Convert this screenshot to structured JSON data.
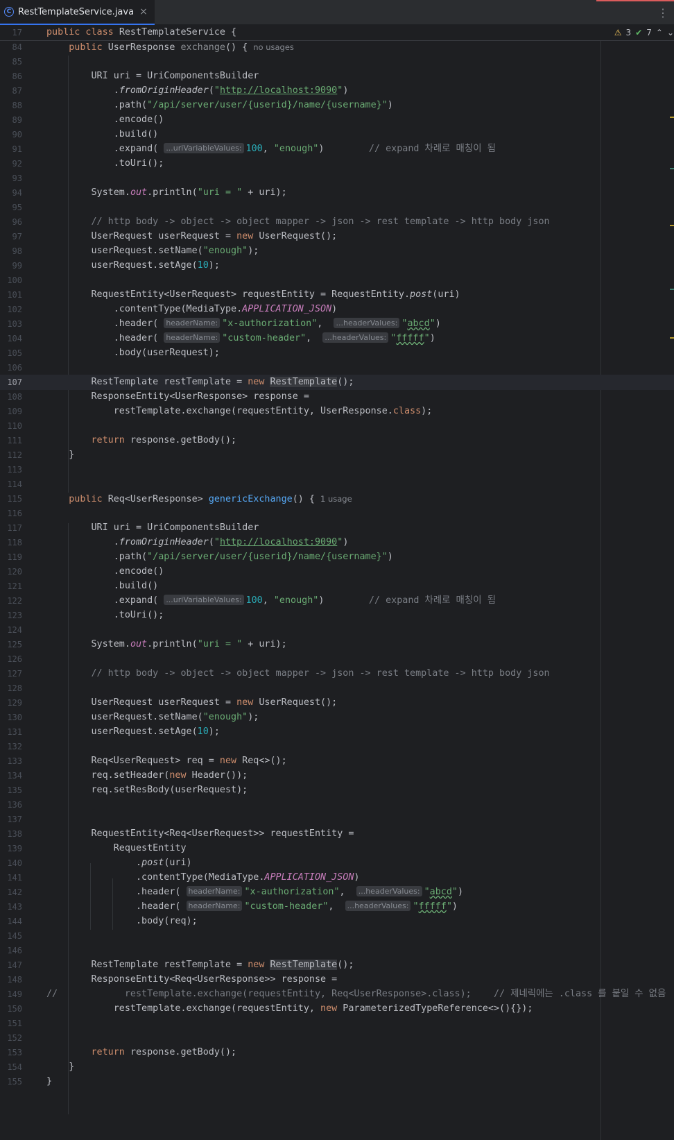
{
  "tab": {
    "file_name": "RestTemplateService.java",
    "icon": "java-class-icon",
    "close": "×"
  },
  "menu_icon": "⋮",
  "inspections": {
    "warnings": "3",
    "ok": "7",
    "up": "⌃",
    "down": "⌄"
  },
  "colors": {
    "keyword": "#cf8e6d",
    "string": "#6aab73",
    "number": "#2aacb8",
    "comment": "#7a7e85",
    "method": "#56a8f5",
    "static": "#c77dbb",
    "accent": "#3574f0"
  },
  "lines": [
    {
      "n": "17",
      "parts": [
        [
          "kw",
          "public class "
        ],
        [
          "",
          "RestTemplateService {"
        ]
      ],
      "sticky": true
    },
    {
      "n": "84",
      "parts": [
        [
          "",
          "    "
        ],
        [
          "kw",
          "public "
        ],
        [
          "",
          "UserResponse "
        ],
        [
          "unused",
          "exchange"
        ],
        [
          "",
          "() {"
        ],
        [
          "usage",
          "no usages"
        ]
      ]
    },
    {
      "n": "85",
      "parts": []
    },
    {
      "n": "86",
      "parts": [
        [
          "",
          "        URI uri = UriComponentsBuilder"
        ]
      ]
    },
    {
      "n": "87",
      "parts": [
        [
          "",
          "            ."
        ],
        [
          "ital",
          "fromOriginHeader"
        ],
        [
          "",
          "("
        ],
        [
          "str",
          "\""
        ],
        [
          "str url",
          "http://localhost:9090"
        ],
        [
          "str",
          "\""
        ],
        [
          "",
          ")"
        ]
      ]
    },
    {
      "n": "88",
      "parts": [
        [
          "",
          "            .path("
        ],
        [
          "str",
          "\"/api/server/user/{userid}/name/{username}\""
        ],
        [
          "",
          ")"
        ]
      ]
    },
    {
      "n": "89",
      "parts": [
        [
          "",
          "            .encode()"
        ]
      ]
    },
    {
      "n": "90",
      "parts": [
        [
          "",
          "            .build()"
        ]
      ]
    },
    {
      "n": "91",
      "parts": [
        [
          "",
          "            .expand( "
        ],
        [
          "hint",
          "...uriVariableValues:"
        ],
        [
          "num",
          "100"
        ],
        [
          "",
          ", "
        ],
        [
          "str",
          "\"enough\""
        ],
        [
          "",
          ")        "
        ],
        [
          "cmt",
          "// expand 차례로 매칭이 됨"
        ]
      ]
    },
    {
      "n": "92",
      "parts": [
        [
          "",
          "            .toUri();"
        ]
      ]
    },
    {
      "n": "93",
      "parts": []
    },
    {
      "n": "94",
      "parts": [
        [
          "",
          "        System."
        ],
        [
          "stat",
          "out"
        ],
        [
          "",
          ".println("
        ],
        [
          "str",
          "\"uri = \""
        ],
        [
          "",
          " + uri);"
        ]
      ]
    },
    {
      "n": "95",
      "parts": []
    },
    {
      "n": "96",
      "parts": [
        [
          "cmt",
          "        // http body -> object -> object mapper -> json -> rest template -> http body json"
        ]
      ]
    },
    {
      "n": "97",
      "parts": [
        [
          "",
          "        UserRequest userRequest = "
        ],
        [
          "kw",
          "new "
        ],
        [
          "",
          "UserRequest();"
        ]
      ]
    },
    {
      "n": "98",
      "parts": [
        [
          "",
          "        userRequest.setName("
        ],
        [
          "str",
          "\"enough\""
        ],
        [
          "",
          ");"
        ]
      ]
    },
    {
      "n": "99",
      "parts": [
        [
          "",
          "        userRequest.setAge("
        ],
        [
          "num",
          "10"
        ],
        [
          "",
          ");"
        ]
      ]
    },
    {
      "n": "100",
      "parts": []
    },
    {
      "n": "101",
      "parts": [
        [
          "",
          "        RequestEntity<UserRequest> requestEntity = RequestEntity."
        ],
        [
          "ital",
          "post"
        ],
        [
          "",
          "(uri)"
        ]
      ]
    },
    {
      "n": "102",
      "parts": [
        [
          "",
          "            .contentType(MediaType."
        ],
        [
          "stat",
          "APPLICATION_JSON"
        ],
        [
          "",
          ")"
        ]
      ]
    },
    {
      "n": "103",
      "parts": [
        [
          "",
          "            .header( "
        ],
        [
          "hint",
          "headerName:"
        ],
        [
          "str",
          "\"x-authorization\""
        ],
        [
          "",
          ",  "
        ],
        [
          "hint",
          "...headerValues:"
        ],
        [
          "str",
          "\""
        ],
        [
          "str wavy",
          "abcd"
        ],
        [
          "str",
          "\""
        ],
        [
          "",
          ")"
        ]
      ]
    },
    {
      "n": "104",
      "parts": [
        [
          "",
          "            .header( "
        ],
        [
          "hint",
          "headerName:"
        ],
        [
          "str",
          "\"custom-header\""
        ],
        [
          "",
          ",  "
        ],
        [
          "hint",
          "...headerValues:"
        ],
        [
          "str",
          "\""
        ],
        [
          "str wavy",
          "fffff"
        ],
        [
          "str",
          "\""
        ],
        [
          "",
          ")"
        ]
      ]
    },
    {
      "n": "105",
      "parts": [
        [
          "",
          "            .body(userRequest);"
        ]
      ]
    },
    {
      "n": "106",
      "parts": []
    },
    {
      "n": "107",
      "parts": [
        [
          "",
          "        RestTemplate restTemplate = "
        ],
        [
          "kw",
          "new "
        ],
        [
          "hl",
          "RestTemplate"
        ],
        [
          "",
          "();"
        ]
      ],
      "current": true
    },
    {
      "n": "108",
      "parts": [
        [
          "",
          "        ResponseEntity<UserResponse> response ="
        ]
      ]
    },
    {
      "n": "109",
      "parts": [
        [
          "",
          "            restTemplate.exchange(requestEntity, UserResponse."
        ],
        [
          "kw",
          "class"
        ],
        [
          "",
          ");"
        ]
      ]
    },
    {
      "n": "110",
      "parts": []
    },
    {
      "n": "111",
      "parts": [
        [
          "",
          "        "
        ],
        [
          "kw",
          "return "
        ],
        [
          "",
          "response.getBody();"
        ]
      ]
    },
    {
      "n": "112",
      "parts": [
        [
          "",
          "    }"
        ]
      ]
    },
    {
      "n": "113",
      "parts": []
    },
    {
      "n": "114",
      "parts": []
    },
    {
      "n": "115",
      "parts": [
        [
          "",
          "    "
        ],
        [
          "kw",
          "public "
        ],
        [
          "",
          "Req<UserResponse> "
        ],
        [
          "fn",
          "genericExchange"
        ],
        [
          "",
          "() {"
        ],
        [
          "usage",
          "1 usage"
        ]
      ]
    },
    {
      "n": "116",
      "parts": []
    },
    {
      "n": "117",
      "parts": [
        [
          "",
          "        URI uri = UriComponentsBuilder"
        ]
      ]
    },
    {
      "n": "118",
      "parts": [
        [
          "",
          "            ."
        ],
        [
          "ital",
          "fromOriginHeader"
        ],
        [
          "",
          "("
        ],
        [
          "str",
          "\""
        ],
        [
          "str url",
          "http://localhost:9090"
        ],
        [
          "str",
          "\""
        ],
        [
          "",
          ")"
        ]
      ]
    },
    {
      "n": "119",
      "parts": [
        [
          "",
          "            .path("
        ],
        [
          "str",
          "\"/api/server/user/{userid}/name/{username}\""
        ],
        [
          "",
          ")"
        ]
      ]
    },
    {
      "n": "120",
      "parts": [
        [
          "",
          "            .encode()"
        ]
      ]
    },
    {
      "n": "121",
      "parts": [
        [
          "",
          "            .build()"
        ]
      ]
    },
    {
      "n": "122",
      "parts": [
        [
          "",
          "            .expand( "
        ],
        [
          "hint",
          "...uriVariableValues:"
        ],
        [
          "num",
          "100"
        ],
        [
          "",
          ", "
        ],
        [
          "str",
          "\"enough\""
        ],
        [
          "",
          ")        "
        ],
        [
          "cmt",
          "// expand 차례로 매칭이 됨"
        ]
      ]
    },
    {
      "n": "123",
      "parts": [
        [
          "",
          "            .toUri();"
        ]
      ]
    },
    {
      "n": "124",
      "parts": []
    },
    {
      "n": "125",
      "parts": [
        [
          "",
          "        System."
        ],
        [
          "stat",
          "out"
        ],
        [
          "",
          ".println("
        ],
        [
          "str",
          "\"uri = \""
        ],
        [
          "",
          " + uri);"
        ]
      ]
    },
    {
      "n": "126",
      "parts": []
    },
    {
      "n": "127",
      "parts": [
        [
          "cmt",
          "        // http body -> object -> object mapper -> json -> rest template -> http body json"
        ]
      ]
    },
    {
      "n": "128",
      "parts": []
    },
    {
      "n": "129",
      "parts": [
        [
          "",
          "        UserRequest userRequest = "
        ],
        [
          "kw",
          "new "
        ],
        [
          "",
          "UserRequest();"
        ]
      ]
    },
    {
      "n": "130",
      "parts": [
        [
          "",
          "        userRequest.setName("
        ],
        [
          "str",
          "\"enough\""
        ],
        [
          "",
          ");"
        ]
      ]
    },
    {
      "n": "131",
      "parts": [
        [
          "",
          "        userRequest.setAge("
        ],
        [
          "num",
          "10"
        ],
        [
          "",
          ");"
        ]
      ]
    },
    {
      "n": "132",
      "parts": []
    },
    {
      "n": "133",
      "parts": [
        [
          "",
          "        Req<UserRequest> req = "
        ],
        [
          "kw",
          "new "
        ],
        [
          "",
          "Req<>();"
        ]
      ]
    },
    {
      "n": "134",
      "parts": [
        [
          "",
          "        req.setHeader("
        ],
        [
          "kw",
          "new "
        ],
        [
          "",
          "Header());"
        ]
      ]
    },
    {
      "n": "135",
      "parts": [
        [
          "",
          "        req.setResBody(userRequest);"
        ]
      ]
    },
    {
      "n": "136",
      "parts": []
    },
    {
      "n": "137",
      "parts": []
    },
    {
      "n": "138",
      "parts": [
        [
          "",
          "        RequestEntity<Req<UserRequest>> requestEntity ="
        ]
      ]
    },
    {
      "n": "139",
      "parts": [
        [
          "",
          "            RequestEntity"
        ]
      ]
    },
    {
      "n": "140",
      "parts": [
        [
          "",
          "                ."
        ],
        [
          "ital",
          "post"
        ],
        [
          "",
          "(uri)"
        ]
      ]
    },
    {
      "n": "141",
      "parts": [
        [
          "",
          "                .contentType(MediaType."
        ],
        [
          "stat",
          "APPLICATION_JSON"
        ],
        [
          "",
          ")"
        ]
      ]
    },
    {
      "n": "142",
      "parts": [
        [
          "",
          "                .header( "
        ],
        [
          "hint",
          "headerName:"
        ],
        [
          "str",
          "\"x-authorization\""
        ],
        [
          "",
          ",  "
        ],
        [
          "hint",
          "...headerValues:"
        ],
        [
          "str",
          "\""
        ],
        [
          "str wavy",
          "abcd"
        ],
        [
          "str",
          "\""
        ],
        [
          "",
          ")"
        ]
      ]
    },
    {
      "n": "143",
      "parts": [
        [
          "",
          "                .header( "
        ],
        [
          "hint",
          "headerName:"
        ],
        [
          "str",
          "\"custom-header\""
        ],
        [
          "",
          ",  "
        ],
        [
          "hint",
          "...headerValues:"
        ],
        [
          "str",
          "\""
        ],
        [
          "str wavy",
          "fffff"
        ],
        [
          "str",
          "\""
        ],
        [
          "",
          ")"
        ]
      ]
    },
    {
      "n": "144",
      "parts": [
        [
          "",
          "                .body(req);"
        ]
      ]
    },
    {
      "n": "145",
      "parts": []
    },
    {
      "n": "146",
      "parts": []
    },
    {
      "n": "147",
      "parts": [
        [
          "",
          "        RestTemplate restTemplate = "
        ],
        [
          "kw",
          "new "
        ],
        [
          "hl",
          "RestTemplate"
        ],
        [
          "",
          "();"
        ]
      ]
    },
    {
      "n": "148",
      "parts": [
        [
          "",
          "        ResponseEntity<Req<UserResponse>> response ="
        ]
      ]
    },
    {
      "n": "149",
      "parts": [
        [
          "cmt",
          "//            restTemplate.exchange(requestEntity, Req<UserResponse>.class);    // 제네릭에는 .class 를 붙일 수 없음"
        ]
      ]
    },
    {
      "n": "150",
      "parts": [
        [
          "",
          "            restTemplate.exchange(requestEntity, "
        ],
        [
          "kw",
          "new "
        ],
        [
          "",
          "ParameterizedTypeReference<>(){});"
        ]
      ]
    },
    {
      "n": "151",
      "parts": []
    },
    {
      "n": "152",
      "parts": []
    },
    {
      "n": "153",
      "parts": [
        [
          "",
          "        "
        ],
        [
          "kw",
          "return "
        ],
        [
          "",
          "response.getBody();"
        ]
      ]
    },
    {
      "n": "154",
      "parts": [
        [
          "",
          "    }"
        ]
      ]
    },
    {
      "n": "155",
      "parts": [
        [
          "",
          "}"
        ]
      ]
    }
  ]
}
